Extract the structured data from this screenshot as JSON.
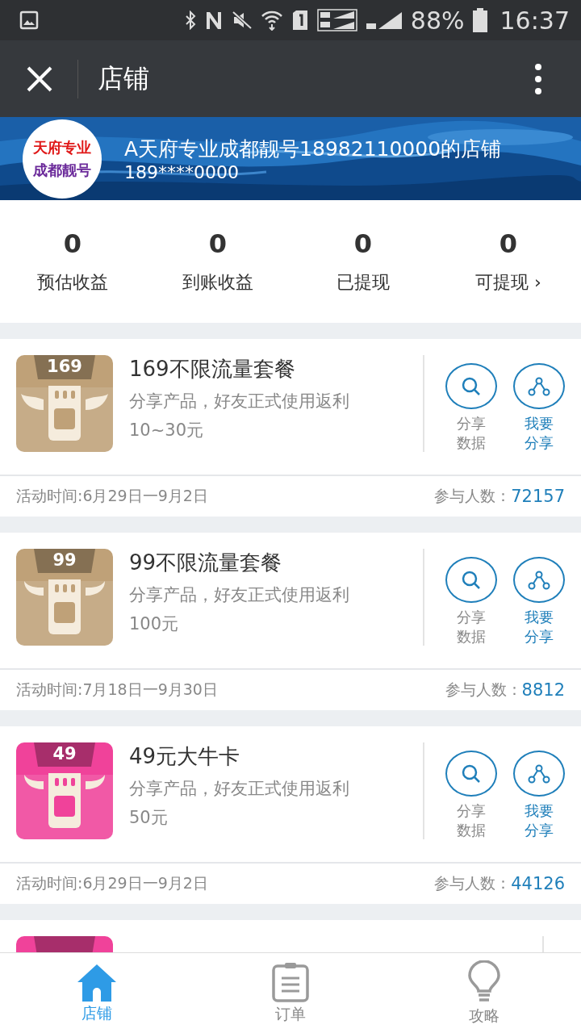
{
  "status_bar": {
    "battery": "88%",
    "time": "16:37"
  },
  "app_bar": {
    "title": "店铺"
  },
  "shop": {
    "logo_top": "天府专业",
    "logo_bottom": "成都靓号",
    "name": "A天府专业成都靓号18982110000的店铺",
    "phone": "189****0000"
  },
  "stats": [
    {
      "value": "0",
      "label": "预估收益"
    },
    {
      "value": "0",
      "label": "到账收益"
    },
    {
      "value": "0",
      "label": "已提现"
    },
    {
      "value": "0",
      "label": "可提现 ›"
    }
  ],
  "products": [
    {
      "badge": "169",
      "color": "#bfa178",
      "kind": "wings",
      "title": "169不限流量套餐",
      "desc": "分享产品，好友正式使用返利",
      "reward": "10~30元",
      "actions": [
        {
          "kind": "data",
          "label": "分享数据"
        },
        {
          "kind": "share",
          "label": "我要分享"
        }
      ],
      "period": "活动时间:6月29日一9月2日",
      "participants_label": "参与人数：",
      "participants": "72157"
    },
    {
      "badge": "99",
      "color": "#bfa178",
      "kind": "horns",
      "title": "99不限流量套餐",
      "desc": "分享产品，好友正式使用返利",
      "reward": "100元",
      "actions": [
        {
          "kind": "data",
          "label": "分享数据"
        },
        {
          "kind": "share",
          "label": "我要分享"
        }
      ],
      "period": "活动时间:7月18日一9月30日",
      "participants_label": "参与人数：",
      "participants": "8812"
    },
    {
      "badge": "49",
      "color": "#f0429a",
      "kind": "horns",
      "title": "49元大牛卡",
      "desc": "分享产品，好友正式使用返利",
      "reward": "50元",
      "actions": [
        {
          "kind": "data",
          "label": "分享数据"
        },
        {
          "kind": "share",
          "label": "我要分享"
        }
      ],
      "period": "活动时间:6月29日一9月2日",
      "participants_label": "参与人数：",
      "participants": "44126"
    },
    {
      "color": "#f0429a",
      "kind": "horns"
    }
  ],
  "nav": [
    {
      "kind": "home",
      "label": "店铺",
      "selected": true
    },
    {
      "kind": "orders",
      "label": "订单",
      "selected": false
    },
    {
      "kind": "tips",
      "label": "攻略",
      "selected": false
    }
  ]
}
